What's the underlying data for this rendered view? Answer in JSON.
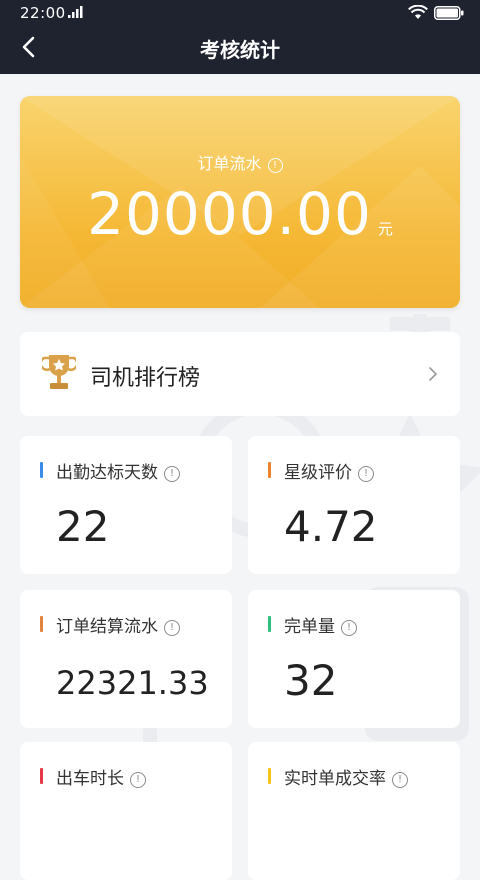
{
  "status_bar": {
    "time": "22:00"
  },
  "nav": {
    "title": "考核统计",
    "back_icon": "chevron-left-icon"
  },
  "hero": {
    "label": "订单流水",
    "value": "20000.00",
    "unit": "元",
    "info_glyph": "!"
  },
  "rank": {
    "title": "司机排行榜",
    "icon": "trophy-icon"
  },
  "stats": [
    {
      "label": "出勤达标天数",
      "value": "22",
      "accent": "#3b8be8"
    },
    {
      "label": "星级评价",
      "value": "4.72",
      "accent": "#f0822e"
    },
    {
      "label": "订单结算流水",
      "value": "22321.33",
      "accent": "#e0853a"
    },
    {
      "label": "完单量",
      "value": "32",
      "accent": "#2ec27e"
    },
    {
      "label": "出车时长",
      "value": "",
      "accent": "#e6394a"
    },
    {
      "label": "实时单成交率",
      "value": "",
      "accent": "#f5c518"
    }
  ],
  "colors": {
    "nav_bg": "#1f2330",
    "hero_start": "#f9d46e",
    "hero_end": "#f2ad25",
    "page_bg": "#f4f5f7"
  }
}
